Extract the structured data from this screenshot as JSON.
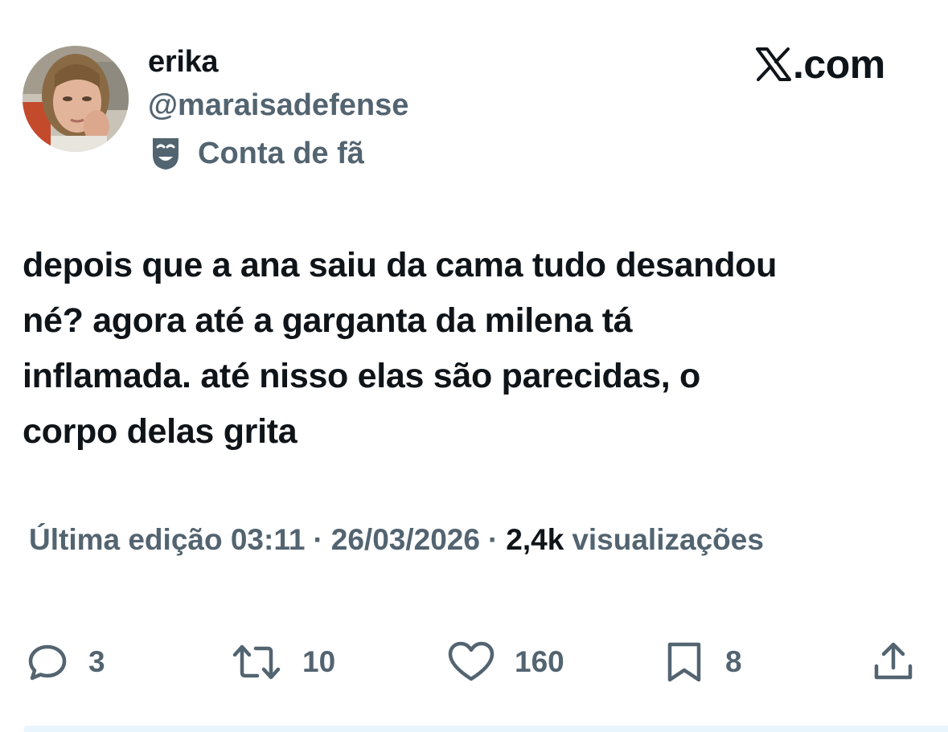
{
  "author": {
    "display_name": "erika",
    "handle": "@maraisadefense",
    "label": "Conta de fã",
    "label_icon": "theater-mask-icon"
  },
  "brand": {
    "text": ".com",
    "logo_icon": "x-logo-icon"
  },
  "tweet": {
    "lines": [
      "depois que a ana saiu da cama tudo desandou",
      "né? agora até a garganta da milena tá",
      "inflamada. até nisso elas são parecidas, o",
      "corpo delas grita"
    ]
  },
  "meta": {
    "edited": "Última edição 03:11",
    "separator": "·",
    "date": "26/03/2026",
    "views_count": "2,4k",
    "views_label": "visualizações"
  },
  "actions": {
    "replies": "3",
    "retweets": "10",
    "likes": "160",
    "bookmarks": "8"
  },
  "colors": {
    "text": "#0f1419",
    "secondary": "#536471",
    "background": "#ffffff"
  }
}
